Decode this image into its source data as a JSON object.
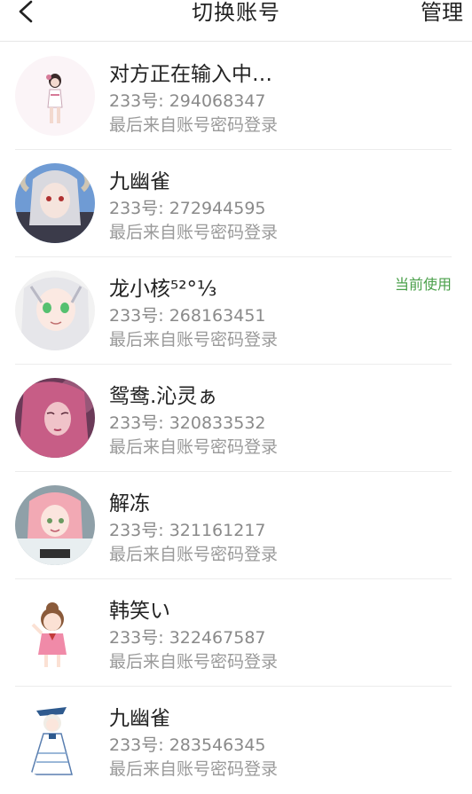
{
  "nav": {
    "title": "切换账号",
    "manage_label": "管理",
    "back_icon": "chevron-left-icon"
  },
  "accent": {
    "current_badge_color": "#4aa04a"
  },
  "accounts": [
    {
      "name": "对方正在输入中…",
      "uid": "233号: 294068347",
      "login": "最后来自账号密码登录",
      "badge": ""
    },
    {
      "name": "九幽雀",
      "uid": "233号: 272944595",
      "login": "最后来自账号密码登录",
      "badge": ""
    },
    {
      "name": "龙小核⁵²°⅓",
      "uid": "233号: 268163451",
      "login": "最后来自账号密码登录",
      "badge": "当前使用"
    },
    {
      "name": "鸳鸯.沁灵ぁ",
      "uid": "233号: 320833532",
      "login": "最后来自账号密码登录",
      "badge": ""
    },
    {
      "name": "解冻",
      "uid": "233号: 321161217",
      "login": "最后来自账号密码登录",
      "badge": ""
    },
    {
      "name": "韩笑い",
      "uid": "233号: 322467587",
      "login": "最后来自账号密码登录",
      "badge": ""
    },
    {
      "name": "九幽雀",
      "uid": "233号: 283546345",
      "login": "最后来自账号密码登录",
      "badge": ""
    }
  ]
}
